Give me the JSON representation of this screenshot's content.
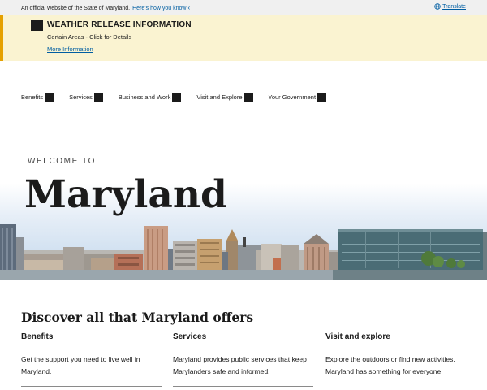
{
  "official_banner": {
    "text": "An official website of the State of Maryland.",
    "how_link": "Here's how you know",
    "chevron": "‹",
    "translate": "Translate",
    "translate_icon": "globe-icon"
  },
  "alert": {
    "title": "WEATHER RELEASE INFORMATION",
    "subtitle": "Certain Areas - Click for Details",
    "link": "More Information",
    "accent_color": "#e5a000",
    "background_color": "#faf3d1"
  },
  "nav": {
    "items": [
      {
        "label": "Benefits"
      },
      {
        "label": "Services"
      },
      {
        "label": "Business and Work"
      },
      {
        "label": "Visit and Explore"
      },
      {
        "label": "Your Government"
      }
    ]
  },
  "hero": {
    "eyebrow": "WELCOME TO",
    "title": "Maryland"
  },
  "discover": {
    "heading": "Discover all that Maryland offers",
    "columns": [
      {
        "title": "Benefits",
        "text": "Get the support you need to live well in Maryland."
      },
      {
        "title": "Services",
        "text": "Maryland provides public services that keep Marylanders safe and informed."
      },
      {
        "title": "Visit and explore",
        "text": "Explore the outdoors or find new activities. Maryland has something for everyone."
      }
    ]
  },
  "colors": {
    "link": "#005ea2",
    "text": "#1b1b1b"
  }
}
